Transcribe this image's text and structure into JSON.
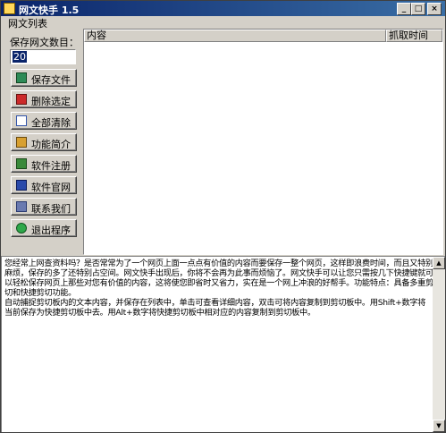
{
  "window": {
    "title": "网文快手 1.5",
    "buttons": {
      "minimize": "_",
      "maximize": "□",
      "close": "×"
    }
  },
  "menu": {
    "items": [
      "网文列表"
    ]
  },
  "sidebar": {
    "count_label": "保存网文数目：",
    "count_value": "20",
    "buttons": [
      {
        "label": "保存文件",
        "icon": "save-icon"
      },
      {
        "label": "删除选定",
        "icon": "delete-icon"
      },
      {
        "label": "全部清除",
        "icon": "clear-all-icon"
      },
      {
        "label": "功能简介",
        "icon": "info-icon"
      },
      {
        "label": "软件注册",
        "icon": "register-icon"
      },
      {
        "label": "软件官网",
        "icon": "website-icon"
      },
      {
        "label": "联系我们",
        "icon": "contact-icon"
      },
      {
        "label": "退出程序",
        "icon": "exit-icon"
      }
    ]
  },
  "list": {
    "columns": [
      "内容",
      "抓取时间"
    ],
    "rows": []
  },
  "description": {
    "text": "您经常上网查资料吗？是否常常为了一个网页上面一点点有价值的内容而要保存一整个网页，这样即浪费时间，而且又特别麻烦，保存的多了还特别占空间。网文快手出现后，你将不会再为此事而烦恼了。网文快手可以让您只需按几下快捷键就可以轻松保存网页上那些对您有价值的内容，这将使您即省时又省力，实在是一个网上冲浪的好帮手。功能特点：具备多重剪切和快捷剪切功能。\n自动捕捉剪切板内的文本内容，并保存在列表中，单击可查看详细内容，双击可将内容复制到剪切板中。用Shift+数字将当前保存为快捷剪切板中去。用Alt+数字将快捷剪切板中相对应的内容复制到剪切板中。"
  },
  "scrollbar": {
    "up": "▲",
    "down": "▼"
  }
}
